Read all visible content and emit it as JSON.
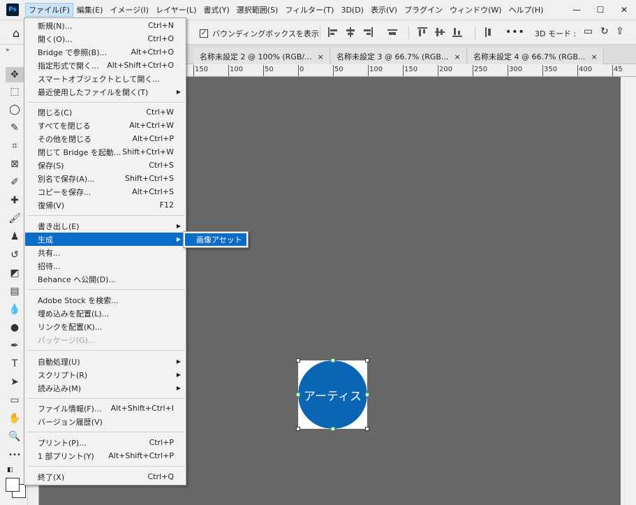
{
  "app": {
    "logo_text": "Ps",
    "accent_color": "#0a6cc6",
    "canvas_color": "#676767",
    "shape_color": "#0a65b4"
  },
  "menubar": {
    "items": [
      "ファイル(F)",
      "編集(E)",
      "イメージ(I)",
      "レイヤー(L)",
      "書式(Y)",
      "選択範囲(S)",
      "フィルター(T)",
      "3D(D)",
      "表示(V)",
      "プラグイン",
      "ウィンドウ(W)",
      "ヘルプ(H)"
    ],
    "window_controls": [
      "—",
      "☐",
      "✕"
    ]
  },
  "options": {
    "bbox_label": "バウンディングボックスを表示",
    "bbox_checked": "✓",
    "mode_3d": "3D モード :",
    "more": "•••"
  },
  "tabs": [
    {
      "label": "名称未設定 2 @ 100% (RGB/...",
      "close": "×"
    },
    {
      "label": "名称未設定 3 @ 66.7% (RGB...",
      "close": "×"
    },
    {
      "label": "名称未設定 4 @ 66.7% (RGB...",
      "close": "×"
    }
  ],
  "ruler": {
    "labels": [
      "150",
      "100",
      "50",
      "0",
      "50",
      "100",
      "150",
      "200",
      "250",
      "300",
      "350",
      "400",
      "45"
    ]
  },
  "canvas": {
    "shape_text": "アーティス"
  },
  "file_menu": {
    "items": [
      {
        "label": "新規(N)...",
        "shortcut": "Ctrl+N"
      },
      {
        "label": "開く(O)...",
        "shortcut": "Ctrl+O"
      },
      {
        "label": "Bridge で参照(B)...",
        "shortcut": "Alt+Ctrl+O"
      },
      {
        "label": "指定形式で開く...",
        "shortcut": "Alt+Shift+Ctrl+O"
      },
      {
        "label": "スマートオブジェクトとして開く...",
        "shortcut": ""
      },
      {
        "label": "最近使用したファイルを開く(T)",
        "shortcut": "",
        "submenu": "▶"
      },
      {
        "label": "閉じる(C)",
        "shortcut": "Ctrl+W"
      },
      {
        "label": "すべてを閉じる",
        "shortcut": "Alt+Ctrl+W"
      },
      {
        "label": "その他を閉じる",
        "shortcut": "Alt+Ctrl+P"
      },
      {
        "label": "閉じて Bridge を起動...",
        "shortcut": "Shift+Ctrl+W"
      },
      {
        "label": "保存(S)",
        "shortcut": "Ctrl+S"
      },
      {
        "label": "別名で保存(A)...",
        "shortcut": "Shift+Ctrl+S"
      },
      {
        "label": "コピーを保存...",
        "shortcut": "Alt+Ctrl+S"
      },
      {
        "label": "復帰(V)",
        "shortcut": "F12"
      },
      {
        "label": "書き出し(E)",
        "shortcut": "",
        "submenu": "▶"
      },
      {
        "label": "生成",
        "shortcut": "",
        "submenu": "▶"
      },
      {
        "label": "共有...",
        "shortcut": ""
      },
      {
        "label": "招待...",
        "shortcut": ""
      },
      {
        "label": "Behance へ公開(D)...",
        "shortcut": ""
      },
      {
        "label": "Adobe Stock を検索...",
        "shortcut": ""
      },
      {
        "label": "埋め込みを配置(L)...",
        "shortcut": ""
      },
      {
        "label": "リンクを配置(K)...",
        "shortcut": ""
      },
      {
        "label": "パッケージ(G)...",
        "shortcut": ""
      },
      {
        "label": "自動処理(U)",
        "shortcut": "",
        "submenu": "▶"
      },
      {
        "label": "スクリプト(R)",
        "shortcut": "",
        "submenu": "▶"
      },
      {
        "label": "読み込み(M)",
        "shortcut": "",
        "submenu": "▶"
      },
      {
        "label": "ファイル情報(F)...",
        "shortcut": "Alt+Shift+Ctrl+I"
      },
      {
        "label": "バージョン履歴(V)",
        "shortcut": ""
      },
      {
        "label": "プリント(P)...",
        "shortcut": "Ctrl+P"
      },
      {
        "label": "1 部プリント(Y)",
        "shortcut": "Alt+Shift+Ctrl+P"
      },
      {
        "label": "終了(X)",
        "shortcut": "Ctrl+Q"
      }
    ]
  },
  "submenu": {
    "item": "画像アセット"
  },
  "toolbar": {
    "collapse": "»",
    "tools": [
      {
        "icon": "move-icon",
        "glyph": "✥"
      },
      {
        "icon": "marquee-icon",
        "glyph": "⬚"
      },
      {
        "icon": "lasso-icon",
        "glyph": "◯"
      },
      {
        "icon": "quick-select-icon",
        "glyph": "✎"
      },
      {
        "icon": "crop-icon",
        "glyph": "⌗"
      },
      {
        "icon": "frame-icon",
        "glyph": "⊠"
      },
      {
        "icon": "eyedropper-icon",
        "glyph": "✐"
      },
      {
        "icon": "healing-icon",
        "glyph": "✚"
      },
      {
        "icon": "brush-icon",
        "glyph": "🖌"
      },
      {
        "icon": "stamp-icon",
        "glyph": "♟"
      },
      {
        "icon": "history-brush-icon",
        "glyph": "↺"
      },
      {
        "icon": "eraser-icon",
        "glyph": "◩"
      },
      {
        "icon": "gradient-icon",
        "glyph": "▤"
      },
      {
        "icon": "blur-icon",
        "glyph": "💧"
      },
      {
        "icon": "dodge-icon",
        "glyph": "●"
      },
      {
        "icon": "pen-icon",
        "glyph": "✒"
      },
      {
        "icon": "type-icon",
        "glyph": "T"
      },
      {
        "icon": "path-select-icon",
        "glyph": "➤"
      },
      {
        "icon": "rectangle-icon",
        "glyph": "▭"
      },
      {
        "icon": "hand-icon",
        "glyph": "✋"
      },
      {
        "icon": "zoom-icon",
        "glyph": "🔍"
      },
      {
        "icon": "more-tools-icon",
        "glyph": "•••"
      }
    ]
  }
}
